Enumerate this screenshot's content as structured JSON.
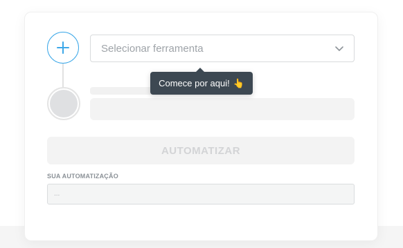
{
  "workflow": {
    "step1": {
      "add_icon": "plus-icon",
      "select_placeholder": "Selecionar ferramenta",
      "select_icon": "chevron-down-icon"
    },
    "tooltip": {
      "text": "Comece por aqui!",
      "emoji": "👆"
    },
    "automate_button": {
      "label": "AUTOMATIZAR",
      "state": "disabled"
    },
    "result": {
      "label": "SUA AUTOMATIZAÇÃO",
      "placeholder": "..."
    }
  },
  "colors": {
    "accent": "#3ba7e8",
    "tooltip_bg": "#3d4852",
    "disabled_bg": "#f3f3f3"
  }
}
